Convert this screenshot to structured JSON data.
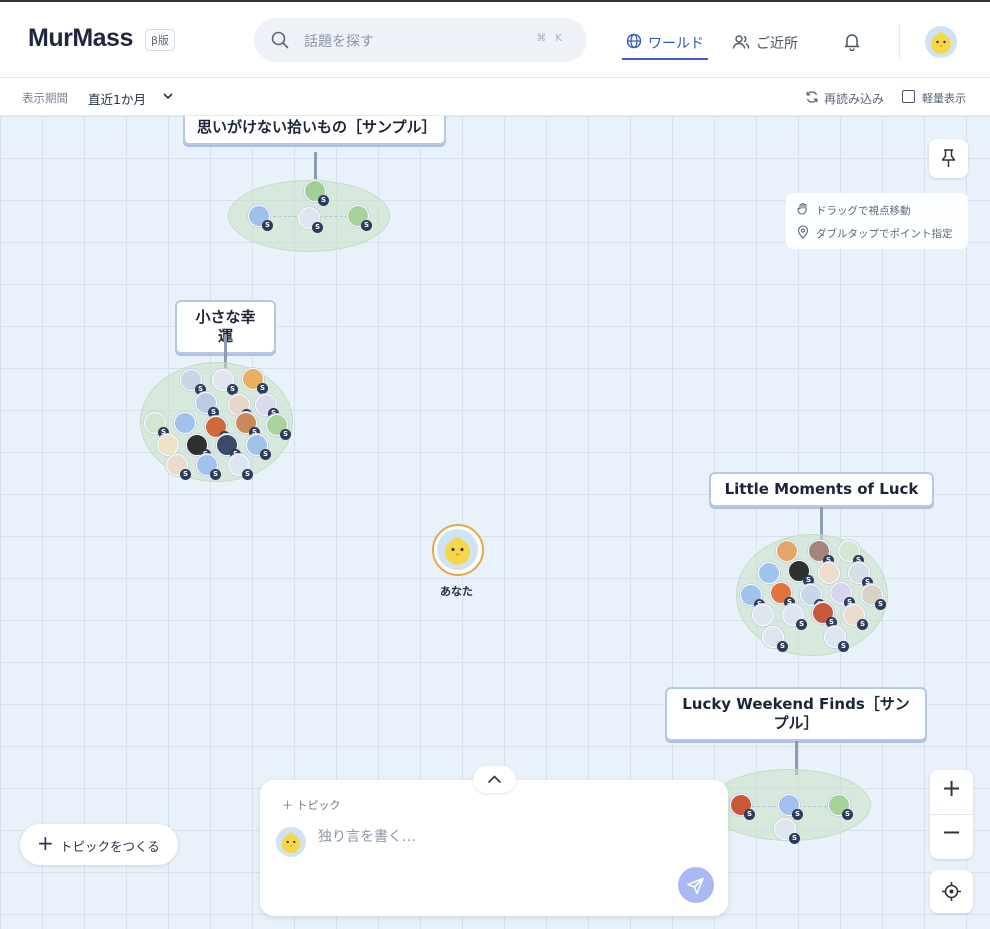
{
  "app": {
    "logo": "MurMass",
    "beta_badge": "β版"
  },
  "search": {
    "placeholder": "話題を探す",
    "shortcut": "⌘ K"
  },
  "nav": {
    "world": "ワールド",
    "nearby": "ご近所"
  },
  "subbar": {
    "period_label": "表示期間",
    "period_value": "直近1か月",
    "reload": "再読み込み",
    "light_mode": "軽量表示",
    "light_mode_checked": false
  },
  "topics": [
    {
      "label": "思いがけない拾いもの［サンプル］"
    },
    {
      "label": "小さな幸運"
    },
    {
      "label": "Little Moments of Luck"
    },
    {
      "label": "Lucky Weekend Finds［サンプル］"
    }
  ],
  "avatar_badge": "S",
  "me": {
    "label": "あなた"
  },
  "hints": {
    "drag": "ドラッグで視点移動",
    "double_tap": "ダブルタップでポイント指定"
  },
  "create_topic": "トピックをつくる",
  "composer": {
    "topic_add": "トピック",
    "placeholder": "独り言を書く…"
  },
  "colors": {
    "accent": "#2f56c2",
    "me_ring": "#e6a747",
    "send": "#a8b9f3",
    "badge": "#2d3a5a"
  }
}
